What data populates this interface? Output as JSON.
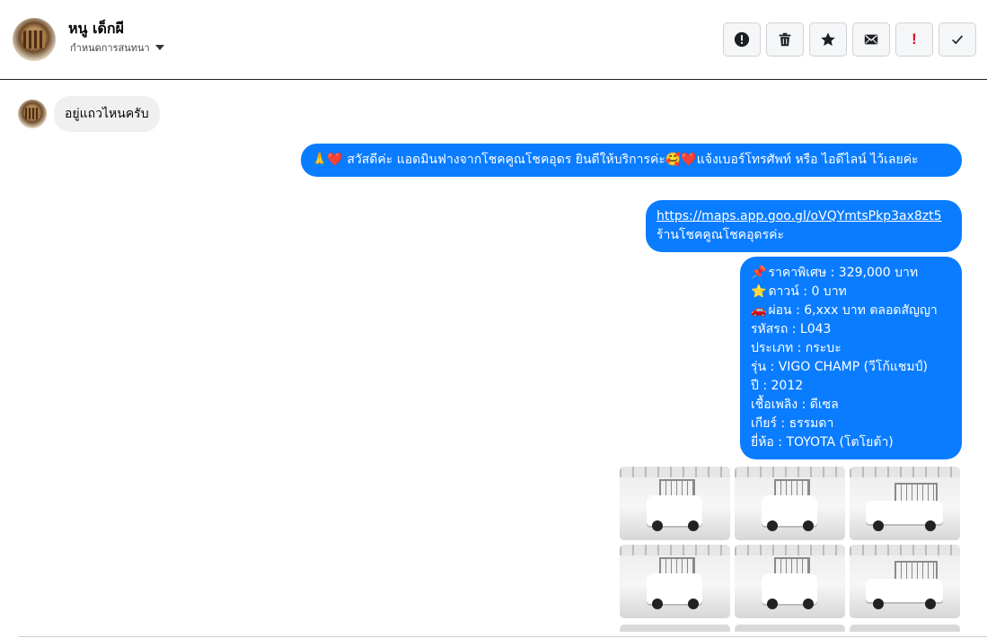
{
  "header": {
    "name": "หนู เด็กผี",
    "subtitle": "กำหนดการสนทนา",
    "actions": [
      {
        "icon": "alert-circle-icon",
        "label": "!"
      },
      {
        "icon": "trash-icon"
      },
      {
        "icon": "star-icon"
      },
      {
        "icon": "envelope-icon"
      },
      {
        "icon": "exclamation-icon",
        "label": "!"
      },
      {
        "icon": "check-icon"
      }
    ]
  },
  "colors": {
    "outgoing_bubble": "#0a7cff",
    "incoming_bubble": "#f0f0f0",
    "exclamation_red": "#e4002b"
  },
  "messages": {
    "incoming": [
      {
        "text": "อยู่แถวไหนครับ"
      }
    ],
    "outgoing_1": {
      "emoji_prefix": "🙏❤️",
      "text": " สวัสดีค่ะ แอดมินฟางจากโชคคูณโชคอุดร ยินดีให้บริการค่ะ🥰❤️แจ้งเบอร์โทรศัพท์ หรือ ไอดีไลน์  ไว้เลยค่ะ"
    },
    "outgoing_2": {
      "link": "https://maps.app.goo.gl/oVQYmtsPkp3ax8zt5",
      "text": "ร้านโชคคูณโชคอุดรค่ะ"
    },
    "outgoing_3": {
      "lines": [
        {
          "emoji": "📌",
          "text": " ราคาพิเศษ : 329,000 บาท"
        },
        {
          "emoji": "⭐",
          "text": " ดาวน์ : 0 บาท"
        },
        {
          "emoji": "🚗",
          "text": " ผ่อน : 6,xxx บาท ตลอดสัญญา"
        },
        {
          "emoji": "",
          "text": "  รหัสรถ : L043"
        },
        {
          "emoji": "",
          "text": "  ประเภท : กระบะ"
        },
        {
          "emoji": "",
          "text": "  รุ่น : VIGO CHAMP (วีโก้แชมป์)"
        },
        {
          "emoji": "",
          "text": "  ปี : 2012"
        },
        {
          "emoji": "",
          "text": "  เชื้อเพลิง : ดีเซล"
        },
        {
          "emoji": "",
          "text": "  เกียร์ : ธรรมดา"
        },
        {
          "emoji": "",
          "text": "  ยี่ห้อ : TOYOTA (โตโยต้า)"
        }
      ]
    },
    "gallery": [
      {
        "view": "front"
      },
      {
        "view": "rear"
      },
      {
        "view": "front-side"
      },
      {
        "view": "front-angle"
      },
      {
        "view": "rear-high"
      },
      {
        "view": "side"
      }
    ]
  }
}
